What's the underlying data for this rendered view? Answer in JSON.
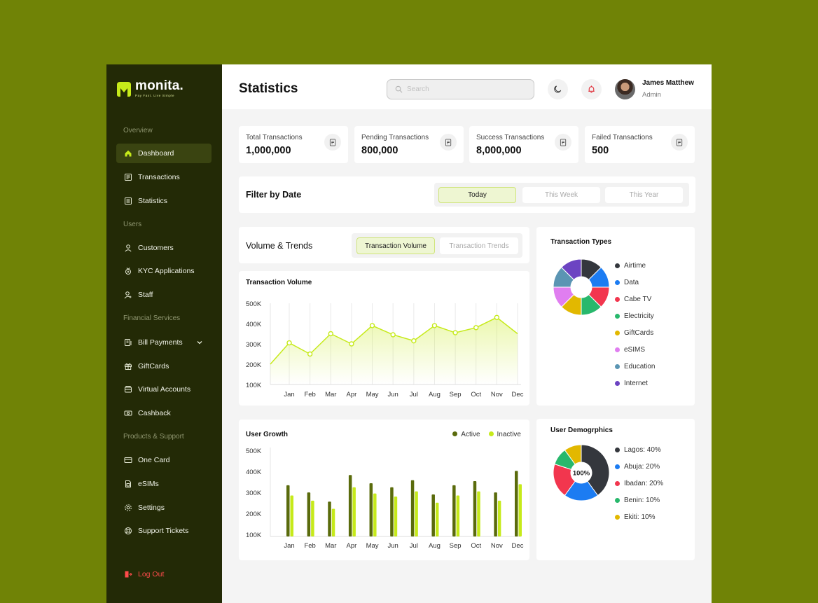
{
  "brand": {
    "name": "monita.",
    "tagline": "Pay Fast. Live Simple",
    "accent": "#c6ea1a"
  },
  "sidebar": {
    "sections": [
      {
        "label": "Overview"
      },
      {
        "label": "Users"
      },
      {
        "label": "Financial Services"
      },
      {
        "label": "Products & Support"
      }
    ],
    "items": [
      {
        "label": "Dashboard",
        "icon": "home-icon"
      },
      {
        "label": "Transactions",
        "icon": "receipt-icon"
      },
      {
        "label": "Statistics",
        "icon": "statistics-icon"
      },
      {
        "label": "Customers",
        "icon": "user-icon"
      },
      {
        "label": "KYC Applications",
        "icon": "badge-icon"
      },
      {
        "label": "Staff",
        "icon": "staff-icon"
      },
      {
        "label": "Bill Payments",
        "icon": "bill-icon"
      },
      {
        "label": "GiftCards",
        "icon": "gift-icon"
      },
      {
        "label": "Virtual Accounts",
        "icon": "wallet-icon"
      },
      {
        "label": "Cashback",
        "icon": "cashback-icon"
      },
      {
        "label": "One Card",
        "icon": "card-icon"
      },
      {
        "label": "eSIMs",
        "icon": "sim-icon"
      },
      {
        "label": "Settings",
        "icon": "gear-icon"
      },
      {
        "label": "Support Tickets",
        "icon": "support-icon"
      }
    ],
    "logout": "Log Out"
  },
  "header": {
    "title": "Statistics",
    "search_placeholder": "Search",
    "user": {
      "name": "James Matthew",
      "role": "Admin"
    }
  },
  "stats": [
    {
      "label": "Total Transactions",
      "value": "1,000,000"
    },
    {
      "label": "Pending Transactions",
      "value": "800,000"
    },
    {
      "label": "Success Transactions",
      "value": "8,000,000"
    },
    {
      "label": "Failed Transactions",
      "value": "500"
    }
  ],
  "filter": {
    "title": "Filter by Date",
    "options": [
      "Today",
      "This Week",
      "This Year"
    ],
    "selected": "Today"
  },
  "volume_trends": {
    "title": "Volume & Trends",
    "tabs": [
      "Transaction Volume",
      "Transaction Trends"
    ],
    "selected": "Transaction Volume"
  },
  "chart_data": [
    {
      "type": "area",
      "title": "Transaction Volume",
      "categories": [
        "Jan",
        "Feb",
        "Mar",
        "Apr",
        "May",
        "Jun",
        "Jul",
        "Aug",
        "Sep",
        "Oct",
        "Nov",
        "Dec"
      ],
      "values": [
        305000,
        250000,
        350000,
        300000,
        390000,
        345000,
        315000,
        390000,
        355000,
        380000,
        430000,
        350000
      ],
      "start_value": 200000,
      "yticks": [
        "500K",
        "400K",
        "300K",
        "200K",
        "100K"
      ],
      "ylim": [
        100000,
        500000
      ],
      "color": "#c6ea1a"
    },
    {
      "type": "bar",
      "title": "User Growth",
      "categories": [
        "Jan",
        "Feb",
        "Mar",
        "Apr",
        "May",
        "Jun",
        "Jul",
        "Aug",
        "Sep",
        "Oct",
        "Nov",
        "Dec"
      ],
      "series": [
        {
          "name": "Active",
          "color": "#5a6b0c",
          "values": [
            350000,
            315000,
            270000,
            400000,
            360000,
            340000,
            375000,
            305000,
            350000,
            370000,
            315000,
            420000
          ]
        },
        {
          "name": "Inactive",
          "color": "#c6ea1a",
          "values": [
            300000,
            275000,
            235000,
            340000,
            310000,
            295000,
            320000,
            265000,
            300000,
            320000,
            275000,
            355000
          ]
        }
      ],
      "yticks": [
        "500K",
        "400K",
        "300K",
        "200K",
        "100K"
      ],
      "ylim": [
        100000,
        500000
      ]
    },
    {
      "type": "pie",
      "title": "Transaction Types",
      "labels": [
        "Airtime",
        "Data",
        "Cabe TV",
        "Electricity",
        "GiftCards",
        "eSIMS",
        "Education",
        "Internet"
      ],
      "values": [
        12.5,
        12.5,
        12.5,
        12.5,
        12.5,
        12.5,
        12.5,
        12.5
      ],
      "colors": [
        "#34373d",
        "#1c7cf2",
        "#f2364e",
        "#28b86c",
        "#e2b800",
        "#e07ef0",
        "#5b95b3",
        "#6c44c2"
      ]
    },
    {
      "type": "pie",
      "title": "User Demogrphics",
      "center_label": "100%",
      "labels": [
        "Lagos: 40%",
        "Abuja: 20%",
        "Ibadan: 20%",
        "Benin: 10%",
        "Ekiti: 10%"
      ],
      "values": [
        40,
        20,
        20,
        10,
        10
      ],
      "colors": [
        "#34373d",
        "#1c7cf2",
        "#f2364e",
        "#28b86c",
        "#e2b800"
      ]
    }
  ]
}
